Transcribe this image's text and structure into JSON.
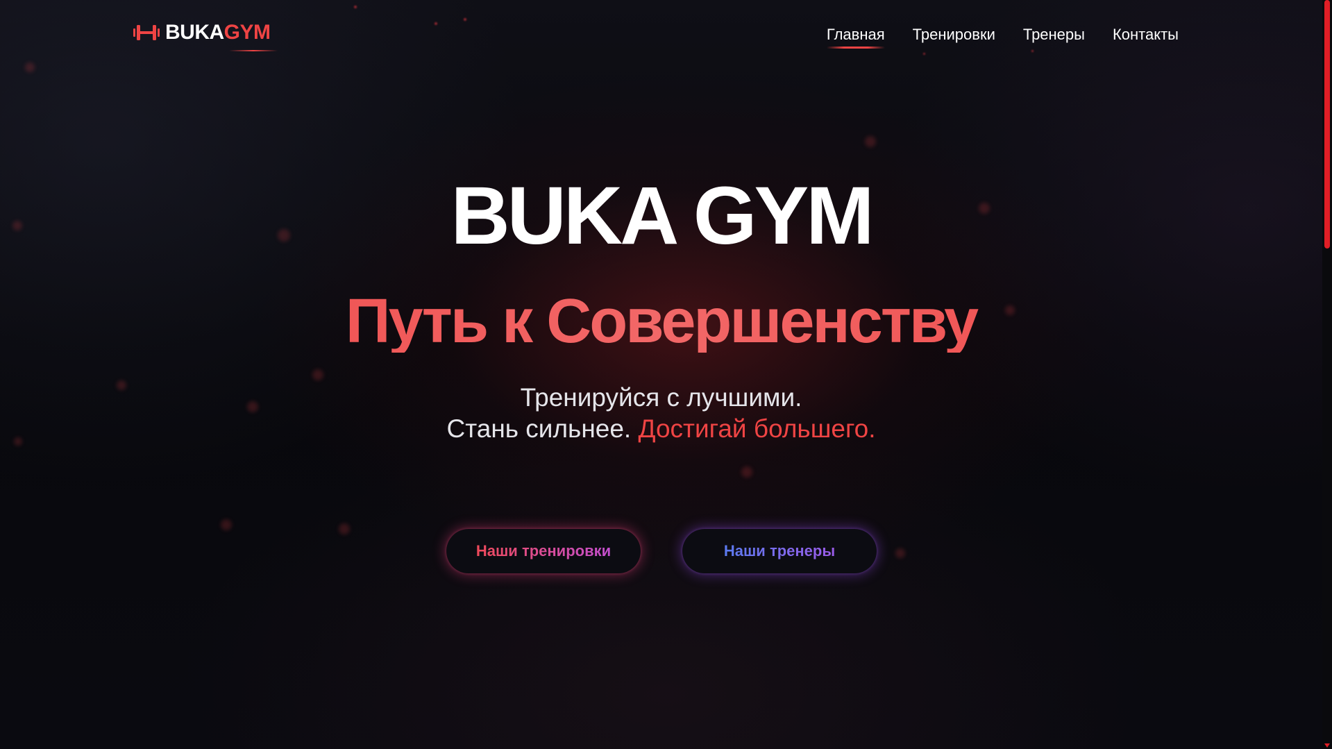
{
  "brand": {
    "name_primary": "BUKA",
    "name_accent": "GYM",
    "icon": "dumbbell-icon",
    "accent_color": "#ef4444"
  },
  "nav": {
    "items": [
      {
        "label": "Главная",
        "active": true
      },
      {
        "label": "Тренировки",
        "active": false
      },
      {
        "label": "Тренеры",
        "active": false
      },
      {
        "label": "Контакты",
        "active": false
      }
    ]
  },
  "hero": {
    "title": "BUKA GYM",
    "subtitle": "Путь к Совершенству",
    "tagline_line1": "Тренируйся с лучшими.",
    "tagline_line2_white": "Стань сильнее.",
    "tagline_line2_red": "Достигай большего."
  },
  "buttons": {
    "workouts_label": "Наши тренировки",
    "trainers_label": "Наши тренеры"
  },
  "scrollbar": {
    "color": "#e01e26",
    "scroll_position": 0
  }
}
